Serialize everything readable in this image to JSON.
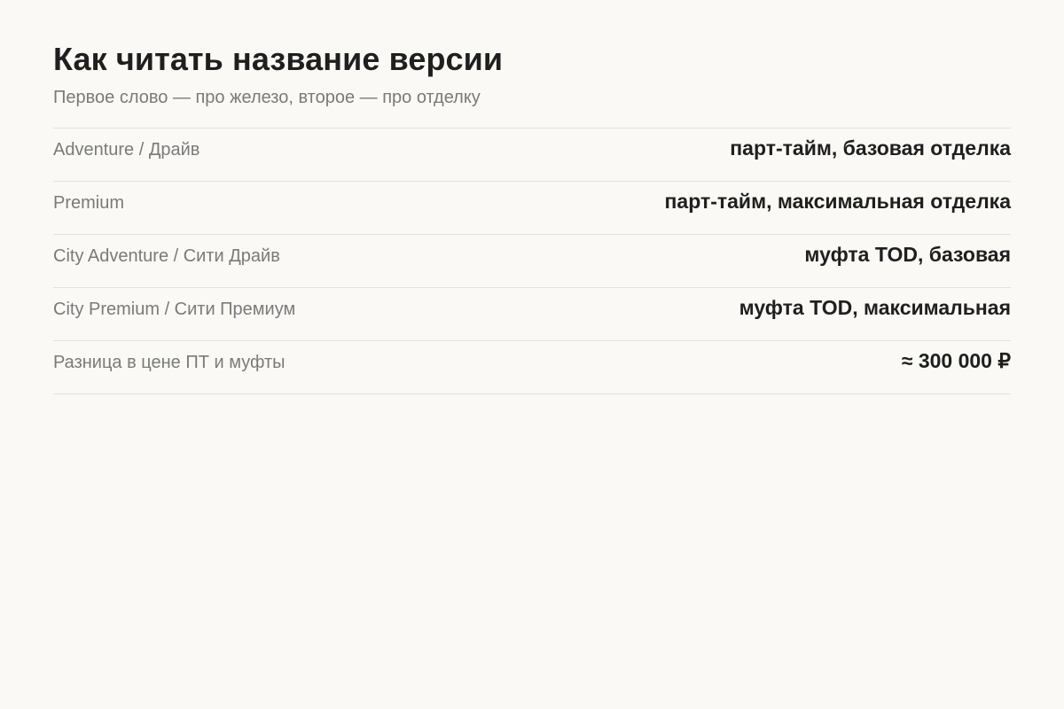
{
  "header": {
    "title": "Как читать название версии",
    "subtitle": "Первое слово — про железо, второе — про отделку"
  },
  "rows": [
    {
      "label": "Adventure / Драйв",
      "value": "парт-тайм, базовая отделка"
    },
    {
      "label": "Premium",
      "value": "парт-тайм, максимальная отделка"
    },
    {
      "label": "City Adventure / Сити Драйв",
      "value": "муфта TOD, базовая"
    },
    {
      "label": "City Premium / Сити Премиум",
      "value": "муфта TOD, максимальная"
    },
    {
      "label": "Разница в цене ПТ и муфты",
      "value": "≈ 300 000 ₽"
    }
  ]
}
